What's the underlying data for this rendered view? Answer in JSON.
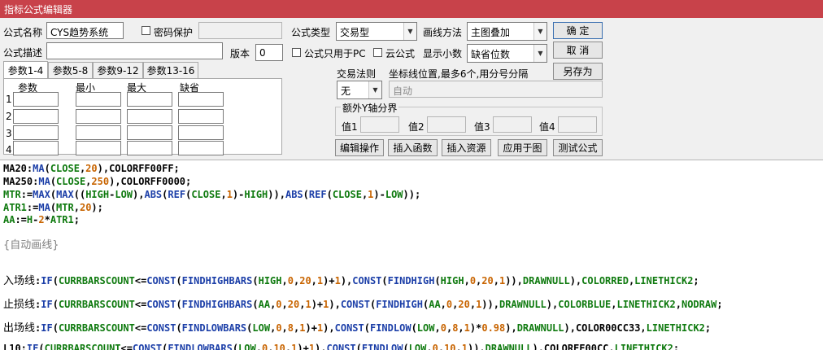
{
  "window": {
    "title": "指标公式编辑器"
  },
  "form": {
    "name_label": "公式名称",
    "name_value": "CYS趋势系统",
    "password_label": "密码保护",
    "desc_label": "公式描述",
    "version_label": "版本",
    "version_value": "0",
    "pc_only_label": "公式只用于PC",
    "cloud_label": "云公式",
    "type_label": "公式类型",
    "type_value": "交易型",
    "draw_label": "画线方法",
    "draw_value": "主图叠加",
    "decimals_label": "显示小数",
    "decimals_value": "缺省位数"
  },
  "buttons": {
    "ok": "确 定",
    "cancel": "取 消",
    "save_as": "另存为",
    "edit_ops": "编辑操作",
    "insert_func": "插入函数",
    "insert_res": "插入资源",
    "apply_chart": "应用于图",
    "test": "测试公式"
  },
  "tabs": [
    "参数1-4",
    "参数5-8",
    "参数9-12",
    "参数13-16"
  ],
  "params": {
    "headers": [
      "参数",
      "最小",
      "最大",
      "缺省"
    ],
    "rows": [
      "1",
      "2",
      "3",
      "4"
    ]
  },
  "trade": {
    "rule_label": "交易法则",
    "rule_value": "无",
    "coord_label": "坐标线位置,最多6个,用分号分隔",
    "coord_placeholder": "自动"
  },
  "yaxis": {
    "group_label": "额外Y轴分界",
    "v1": "值1",
    "v2": "值2",
    "v3": "值3",
    "v4": "值4"
  },
  "code_lines": [
    "MA20:MA(CLOSE,20),COLORFF00FF;",
    "MA250:MA(CLOSE,250),COLORFF0000;",
    "MTR:=MAX(MAX((HIGH-LOW),ABS(REF(CLOSE,1)-HIGH)),ABS(REF(CLOSE,1)-LOW));",
    "ATR1:=MA(MTR,20);",
    "AA:=H-2*ATR1;",
    "{自动画线}",
    "入场线:IF(CURRBARSCOUNT<=CONST(FINDHIGHBARS(HIGH,0,20,1)+1),CONST(FINDHIGH(HIGH,0,20,1)),DRAWNULL),COLORRED,LINETHICK2;",
    "止损线:IF(CURRBARSCOUNT<=CONST(FINDHIGHBARS(AA,0,20,1)+1),CONST(FINDHIGH(AA,0,20,1)),DRAWNULL),COLORBLUE,LINETHICK2,NODRAW;",
    "出场线:IF(CURRBARSCOUNT<=CONST(FINDLOWBARS(LOW,0,8,1)+1),CONST(FINDLOW(LOW,0,8,1)*0.98),DRAWNULL),COLOR00CC33,LINETHICK2;",
    "L10:IF(CURRBARSCOUNT<=CONST(FINDLOWBARS(LOW,0,10,1)+1),CONST(FINDLOW(LOW,0,10,1)),DRAWNULL),COLORFF00CC,LINETHICK2;"
  ]
}
